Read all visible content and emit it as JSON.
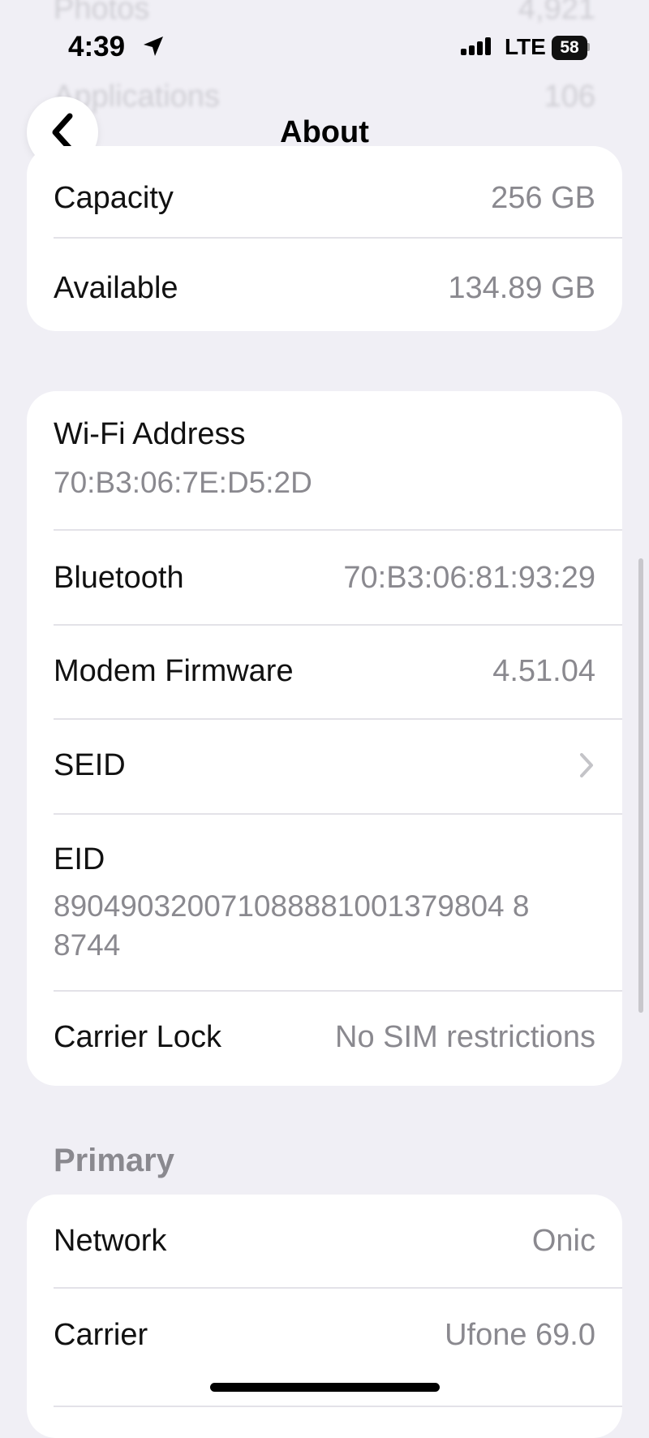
{
  "ghost_rows": [
    {
      "label": "Photos",
      "value": "4,921"
    },
    {
      "label": "Applications",
      "value": "106"
    }
  ],
  "status_bar": {
    "time": "4:39",
    "network": "LTE",
    "battery": "58"
  },
  "nav": {
    "title": "About",
    "back_icon": "chevron-left-icon"
  },
  "storage": {
    "capacity_label": "Capacity",
    "capacity_value": "256 GB",
    "available_label": "Available",
    "available_value": "134.89 GB"
  },
  "identifiers": {
    "wifi_label": "Wi-Fi Address",
    "wifi_value": "70:B3:06:7E:D5:2D",
    "bluetooth_label": "Bluetooth",
    "bluetooth_value": "70:B3:06:81:93:29",
    "modem_label": "Modem Firmware",
    "modem_value": "4.51.04",
    "seid_label": "SEID",
    "eid_label": "EID",
    "eid_line1": "890490320071088881001379804 8",
    "eid_line2": "8744",
    "carrier_lock_label": "Carrier Lock",
    "carrier_lock_value": "No SIM restrictions"
  },
  "primary": {
    "section_title": "Primary",
    "network_label": "Network",
    "network_value": "Onic",
    "carrier_label": "Carrier",
    "carrier_value": "Ufone 69.0"
  }
}
